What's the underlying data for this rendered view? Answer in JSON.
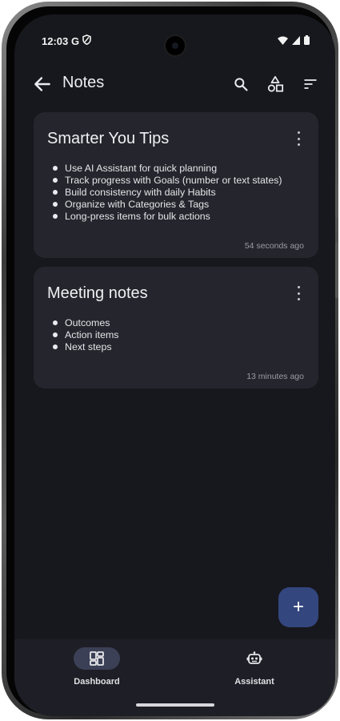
{
  "status_bar": {
    "time": "12:03",
    "carrier_glyph": "G",
    "icons": [
      "shield-icon",
      "wifi-icon",
      "signal-icon",
      "battery-icon"
    ]
  },
  "app_bar": {
    "title": "Notes",
    "actions": [
      "search-icon",
      "shapes-icon",
      "sort-icon"
    ]
  },
  "notes": [
    {
      "title": "Smarter You Tips",
      "bullets": [
        "Use AI Assistant for quick planning",
        "Track progress with Goals (number or text states)",
        "Build consistency with daily Habits",
        "Organize with Categories & Tags",
        "Long-press items for bulk actions"
      ],
      "timestamp": "54 seconds ago"
    },
    {
      "title": "Meeting notes",
      "bullets": [
        "Outcomes",
        "Action items",
        "Next steps"
      ],
      "timestamp": "13 minutes ago"
    }
  ],
  "fab": {
    "label": "+"
  },
  "bottom_nav": {
    "items": [
      {
        "label": "Dashboard",
        "icon": "dashboard-icon",
        "selected": true
      },
      {
        "label": "Assistant",
        "icon": "robot-icon",
        "selected": false
      }
    ]
  },
  "colors": {
    "background": "#17181d",
    "card": "#25262d",
    "fab": "#34467e",
    "nav_pill": "#3b4056"
  }
}
